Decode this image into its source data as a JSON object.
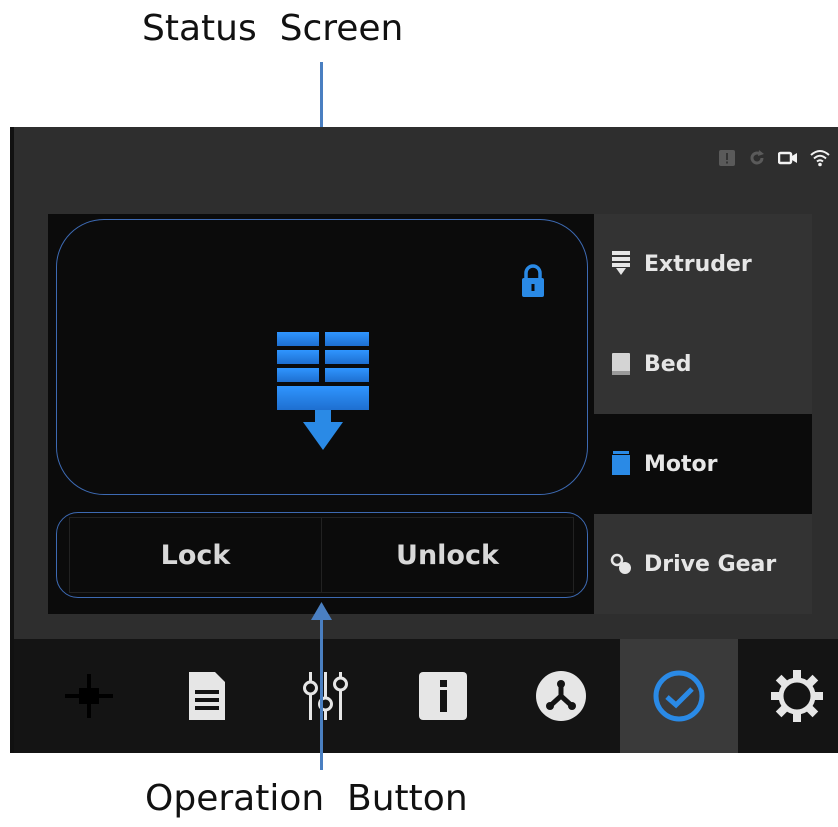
{
  "captions": {
    "top": "Status  Screen",
    "bottom": "Operation  Button"
  },
  "status_bar": {
    "icons": [
      "alert-icon",
      "refresh-icon",
      "camera-icon",
      "wifi-icon"
    ]
  },
  "status_screen": {
    "lock_icon": "padlock-icon",
    "main_icon": "motor-icon"
  },
  "buttons": {
    "lock": "Lock",
    "unlock": "Unlock"
  },
  "side_menu": {
    "items": [
      {
        "label": "Extruder",
        "icon": "extruder-icon"
      },
      {
        "label": "Bed",
        "icon": "bed-icon"
      },
      {
        "label": "Motor",
        "icon": "motor-icon",
        "active": true
      },
      {
        "label": "Drive Gear",
        "icon": "drive-gear-icon"
      }
    ]
  },
  "bottom_nav": {
    "items": [
      "move-icon",
      "file-icon",
      "sliders-icon",
      "info-icon",
      "filament-icon",
      "check-icon",
      "gear-icon"
    ],
    "active_index": 5
  },
  "colors": {
    "accent": "#3d6ab3",
    "icon_blue": "#2a8ae6",
    "panel_bg": "#0b0b0b",
    "device_bg": "#2e2e2e"
  }
}
